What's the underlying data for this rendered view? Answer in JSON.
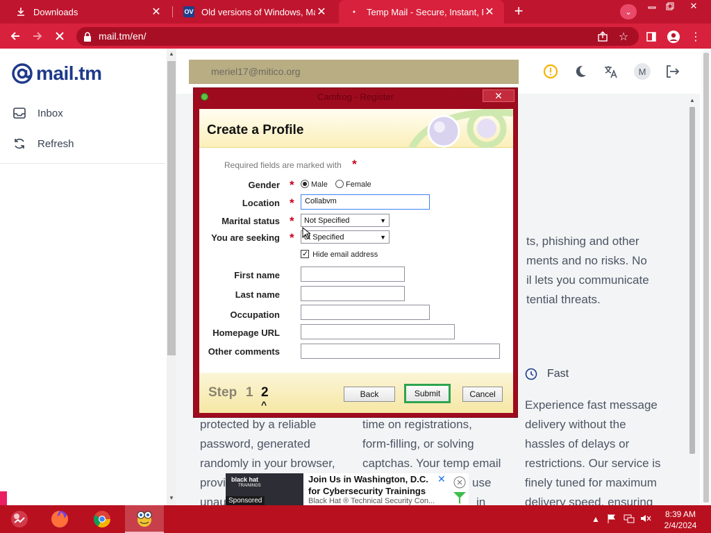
{
  "browser": {
    "tabs": [
      {
        "title": "Downloads",
        "active": false
      },
      {
        "title": "Old versions of Windows, Mac ar",
        "icon_text": "OV",
        "active": false
      },
      {
        "title": "Temp Mail - Secure, Instant, Fast",
        "active": true
      }
    ],
    "url": "mail.tm/en/"
  },
  "site": {
    "logo_text": "mail.tm",
    "nav": [
      {
        "label": "Inbox"
      },
      {
        "label": "Refresh"
      }
    ],
    "email_address": "meriel17@mitico.org",
    "avatar_letter": "M",
    "body_lines": [
      "ts, phishing and other",
      "ments and no risks. No",
      "il lets you communicate",
      "tential threats."
    ],
    "col1_lines": [
      "protected by a reliable",
      "password, generated",
      "randomly in your browser,",
      "provi",
      "unau"
    ],
    "col2_lines": [
      "time on registrations,",
      "form-filling, or solving",
      "captchas. Your temp email",
      "use",
      "in"
    ],
    "col3_heading": "Fast",
    "col3_lines": [
      "Experience fast message",
      "delivery without the",
      "hassles of delays or",
      "restrictions. Our service is",
      "finely tuned for maximum",
      "delivery speed, ensuring"
    ]
  },
  "ad": {
    "image_text": "black hat",
    "image_subtext": "TRAININGS",
    "sponsored": "Sponsored",
    "title_line1": "Join Us in Washington, D.C.",
    "title_line2": "for Cybersecurity Trainings",
    "subtitle": "Black Hat ® Technical Security Con..."
  },
  "dialog": {
    "window_title": "Camfrog - Register",
    "heading": "Create a Profile",
    "required_note": "Required fields are marked with",
    "fields": {
      "gender_label": "Gender",
      "gender_male": "Male",
      "gender_female": "Female",
      "location_label": "Location",
      "location_value": "Collabvm",
      "marital_label": "Marital status",
      "marital_value": "Not Specified",
      "seeking_label": "You are seeking",
      "seeking_value": "ot Specified",
      "hide_email": "Hide email address",
      "first_name_label": "First name",
      "last_name_label": "Last name",
      "occupation_label": "Occupation",
      "homepage_label": "Homepage URL",
      "comments_label": "Other comments"
    },
    "step_label": "Step",
    "step_1": "1",
    "step_2": "2",
    "step_caret": "^",
    "buttons": {
      "back": "Back",
      "submit": "Submit",
      "cancel": "Cancel"
    }
  },
  "taskbar": {
    "time": "8:39 AM",
    "date": "2/4/2024"
  },
  "colors": {
    "chrome_red": "#d8213c",
    "tabbar_red": "#c0152e",
    "dialog_red": "#9e0b1e",
    "brand_blue": "#1e3a8a",
    "submit_green": "#2ea44f"
  }
}
